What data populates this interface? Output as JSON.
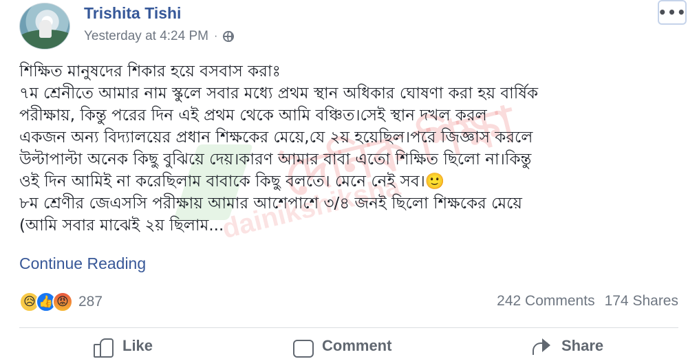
{
  "post": {
    "author": "Trishita Tishi",
    "timestamp": "Yesterday at 4:24 PM",
    "separator": "·",
    "privacy_icon": "globe-icon",
    "more_label": "•••",
    "text_lines": [
      "শিক্ষিত মানুষদের শিকার হয়ে বসবাস করাঃ",
      "৭ম শ্রেনীতে আমার নাম স্কুলে সবার মধ্যে প্রথম স্থান অধিকার ঘোষণা করা হয় বার্ষিক",
      "পরীক্ষায়, কিন্তু পরের দিন এই প্রথম থেকে আমি বঞ্চিত।সেই স্থান দখল করল",
      "একজন অন্য বিদ্যালয়ের প্রধান শিক্ষকের মেয়ে,যে ২য় হয়েছিল।পরে জিজ্ঞাস করলে",
      "উল্টাপাল্টা অনেক কিছু বুঝিয়ে দেয়।কারণ আমার বাবা এতো শিক্ষিত ছিলো না।কিন্তু",
      "ওই দিন আমিই না করেছিলাম বাবাকে কিছু বলতে। মেনে নেই সব।🙂",
      "৮ম শ্রেণীর জেএসসি পরীক্ষায় আমার আশেপাশে ৩/৪ জনই ছিলো শিক্ষকের মেয়ে",
      "(আমি সবার মাঝেই ২য় ছিলাম..."
    ],
    "continue_label": "Continue Reading"
  },
  "reactions": {
    "icons": [
      "sad-icon",
      "like-icon",
      "angry-icon"
    ],
    "sad_glyph": "😥",
    "like_glyph": "👍",
    "angry_glyph": "😡",
    "count": "287"
  },
  "stats": {
    "comments": "242 Comments",
    "shares": "174 Shares"
  },
  "actions": {
    "like": "Like",
    "comment": "Comment",
    "share": "Share"
  },
  "watermark": {
    "title": "দৈনিক শিক্ষা",
    "url": "dainikshiksha"
  },
  "colors": {
    "author": "#365899",
    "link": "#385898",
    "meta": "#6f7782",
    "like_blue": "#1877f2"
  }
}
